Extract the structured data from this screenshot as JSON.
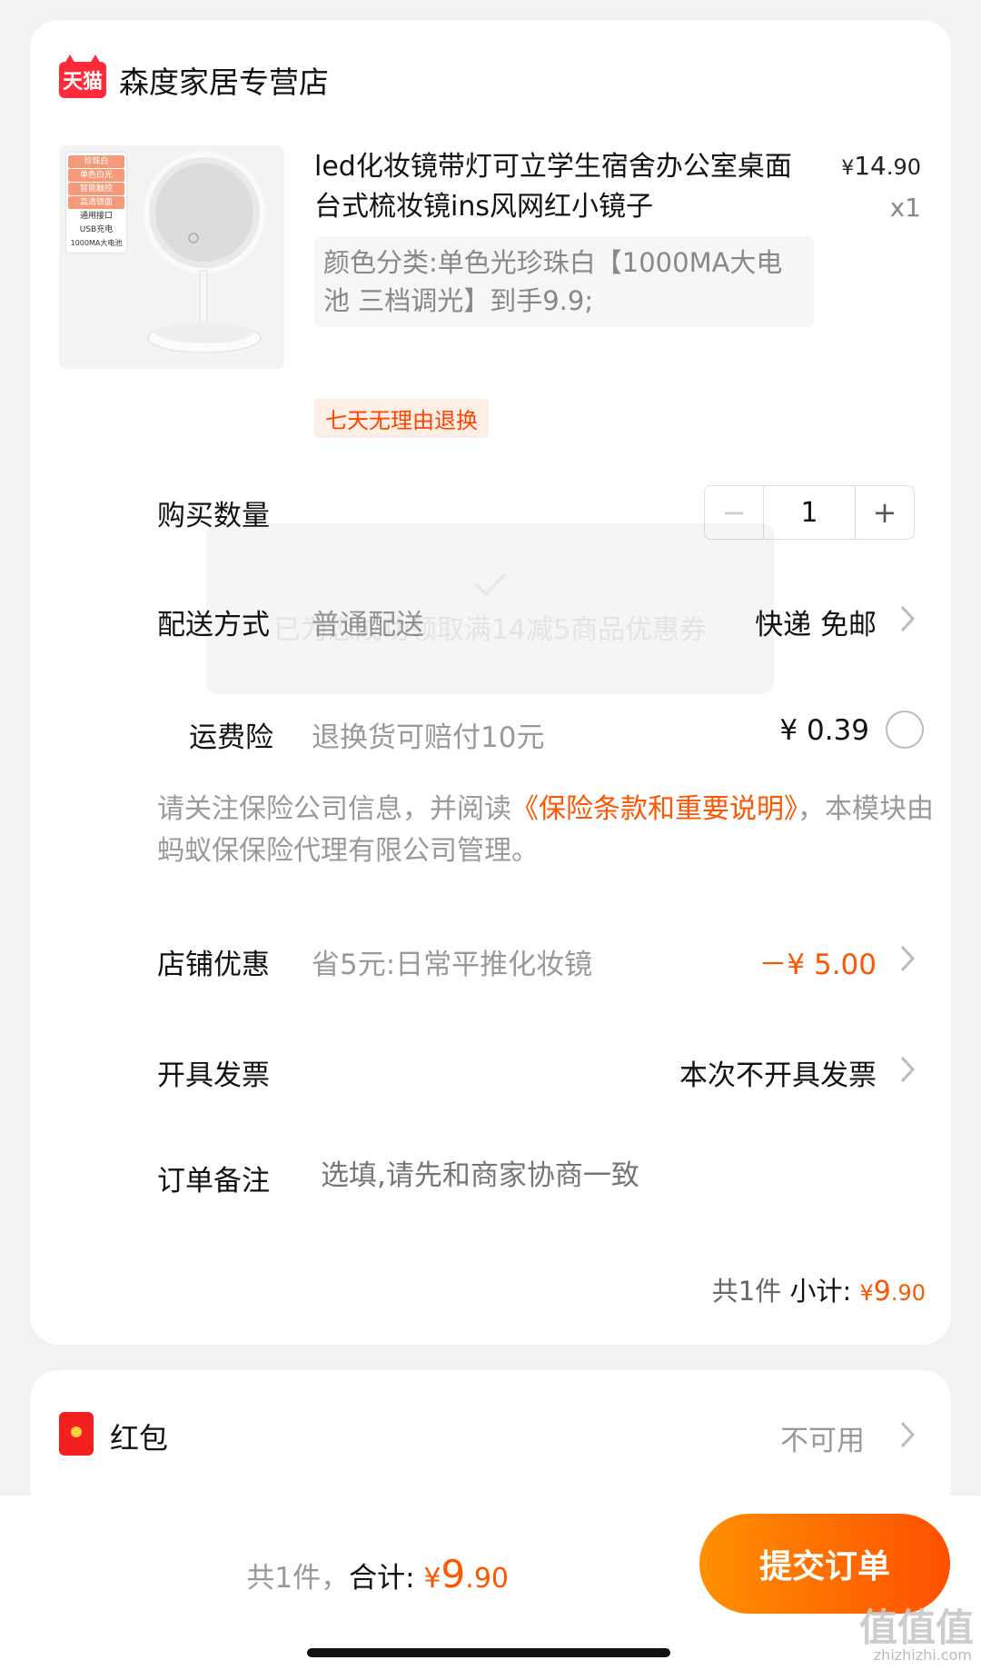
{
  "store": {
    "badge": "天猫",
    "name": "森度家居专营店"
  },
  "product": {
    "title": "led化妆镜带灯可立学生宿舍办公室桌面台式梳妆镜ins风网红小镜子",
    "price_currency": "¥",
    "price_int": "14",
    "price_dec": ".90",
    "quantity_mult": "x1",
    "sku": "颜色分类:单色光珍珠白【1000MA大电池 三档调光】到手9.9;",
    "return_tag": "七天无理由退换",
    "image_tags": [
      "珍珠白",
      "单色白光",
      "智能触控",
      "高清镜面",
      "通用接口",
      "USB充电",
      "1000MA大电池"
    ]
  },
  "quantity": {
    "label": "购买数量",
    "minus": "−",
    "value": "1",
    "plus": "+"
  },
  "delivery": {
    "label": "配送方式",
    "desc": "普通配送",
    "value": "快递 免邮"
  },
  "shipping_insurance": {
    "label": "运费险",
    "desc": "退换货可赔付10元",
    "value": "¥ 0.39"
  },
  "insurance_note": {
    "prefix": "请关注保险公司信息，并阅读",
    "link": "《保险条款和重要说明》",
    "suffix": "，本模块由蚂蚁保保险代理有限公司管理。"
  },
  "store_discount": {
    "label": "店铺优惠",
    "desc": "省5元:日常平推化妆镜",
    "value": "－¥ 5.00"
  },
  "invoice": {
    "label": "开具发票",
    "value": "本次不开具发票"
  },
  "remark": {
    "label": "订单备注",
    "placeholder": "选填,请先和商家协商一致"
  },
  "subtotal": {
    "count": "共1件",
    "label": "小计:",
    "currency": "¥",
    "int": "9",
    "dec": ".90"
  },
  "toast": {
    "message": "已为您成功领取满14减5商品优惠券"
  },
  "red_packet": {
    "label": "红包",
    "status": "不可用"
  },
  "bottom": {
    "count": "共1件，",
    "label": "合计:",
    "currency": "¥",
    "int": "9",
    "dec": ".90",
    "submit": "提交订单",
    "watermark": "值值值",
    "watermark_sub": "zhizhizhi.com"
  },
  "colors": {
    "accent": "#ff5500",
    "tmall_red": "#ff2b3a",
    "button_start": "#ff9000",
    "button_end": "#ff5000"
  }
}
